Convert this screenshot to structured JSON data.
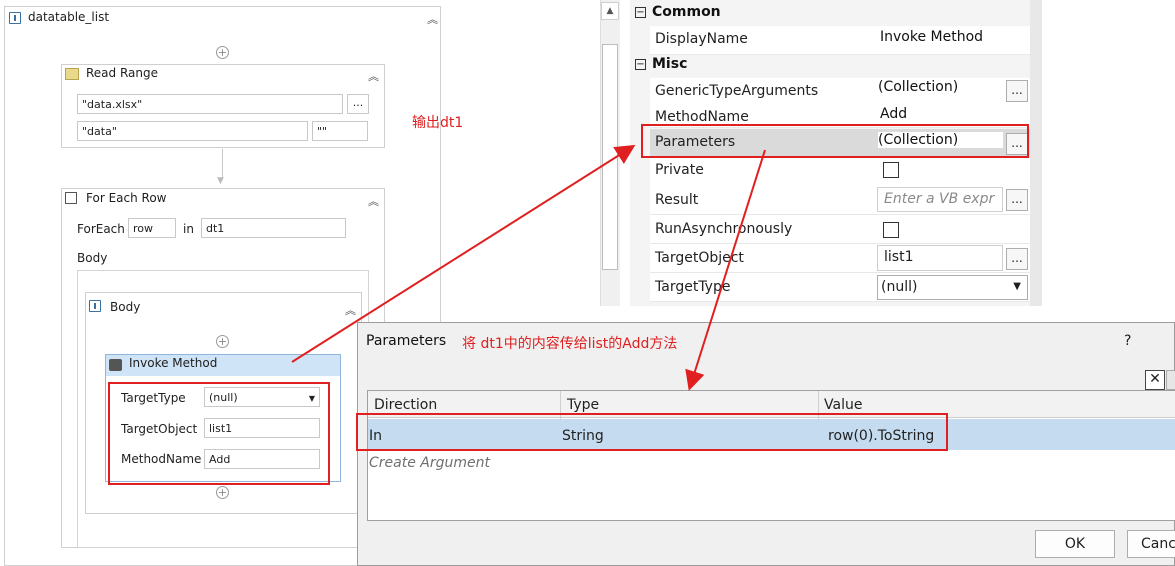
{
  "designer": {
    "sequence_title": "datatable_list",
    "read_range": {
      "title": "Read Range",
      "workbook_path": "\"data.xlsx\"",
      "browse": "...",
      "sheet": "\"data\"",
      "range": "\"\""
    },
    "annotation_output": "输出dt1",
    "for_each_row": {
      "title": "For Each Row",
      "foreach_label": "ForEach",
      "item_var": "row",
      "in_label": "in",
      "collection": "dt1",
      "body_label": "Body",
      "body_sequence_title": "Body"
    },
    "invoke_method": {
      "title": "Invoke Method",
      "target_type_label": "TargetType",
      "target_type_value": "(null)",
      "target_object_label": "TargetObject",
      "target_object_value": "list1",
      "method_name_label": "MethodName",
      "method_name_value": "Add"
    }
  },
  "properties": {
    "category_common": "Common",
    "category_misc": "Misc",
    "rows": {
      "display_name": {
        "name": "DisplayName",
        "value": "Invoke Method"
      },
      "generic_type_arguments": {
        "name": "GenericTypeArguments",
        "value": "(Collection)"
      },
      "method_name": {
        "name": "MethodName",
        "value": "Add"
      },
      "parameters": {
        "name": "Parameters",
        "value": "(Collection)"
      },
      "private": {
        "name": "Private",
        "value": ""
      },
      "result": {
        "name": "Result",
        "placeholder": "Enter a VB expr"
      },
      "run_async": {
        "name": "RunAsynchronously",
        "value": ""
      },
      "target_object": {
        "name": "TargetObject",
        "value": "list1"
      },
      "target_type": {
        "name": "TargetType",
        "value": "(null)"
      }
    },
    "dots": "..."
  },
  "dialog": {
    "title": "Parameters",
    "annotation": "将 dt1中的内容传给list的Add方法",
    "help": "?",
    "columns": [
      "Direction",
      "Type",
      "Value"
    ],
    "row": {
      "direction": "In",
      "type": "String",
      "value": "row(0).ToString"
    },
    "create_argument": "Create Argument",
    "ok": "OK",
    "cancel": "Canc"
  },
  "colors": {
    "annotation_red": "#e02020",
    "selection_blue": "#c5dcf0",
    "activity_header": "#cfe4f7"
  }
}
